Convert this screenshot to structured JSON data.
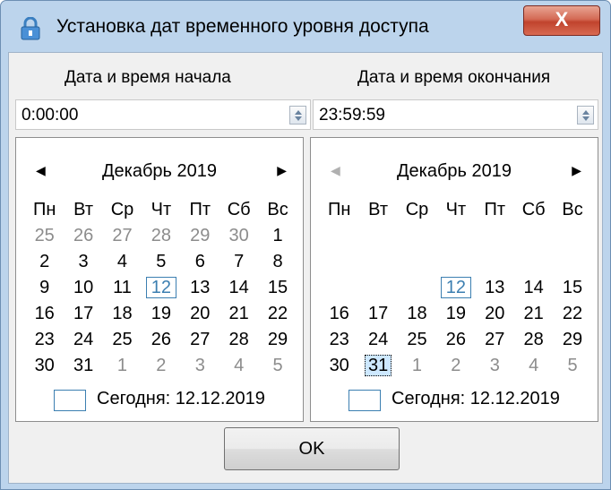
{
  "window": {
    "title": "Установка дат временного уровня доступа",
    "close_label": "X"
  },
  "start": {
    "header": "Дата и время начала",
    "time_value": "0:00:00",
    "month_label": "Декабрь 2019",
    "weekdays": [
      "Пн",
      "Вт",
      "Ср",
      "Чт",
      "Пт",
      "Сб",
      "Вс"
    ],
    "weeks": [
      [
        {
          "d": "25",
          "cls": "other"
        },
        {
          "d": "26",
          "cls": "other"
        },
        {
          "d": "27",
          "cls": "other"
        },
        {
          "d": "28",
          "cls": "other"
        },
        {
          "d": "29",
          "cls": "other"
        },
        {
          "d": "30",
          "cls": "other"
        },
        {
          "d": "1",
          "cls": ""
        }
      ],
      [
        {
          "d": "2",
          "cls": ""
        },
        {
          "d": "3",
          "cls": ""
        },
        {
          "d": "4",
          "cls": ""
        },
        {
          "d": "5",
          "cls": ""
        },
        {
          "d": "6",
          "cls": ""
        },
        {
          "d": "7",
          "cls": ""
        },
        {
          "d": "8",
          "cls": ""
        }
      ],
      [
        {
          "d": "9",
          "cls": ""
        },
        {
          "d": "10",
          "cls": ""
        },
        {
          "d": "11",
          "cls": ""
        },
        {
          "d": "12",
          "cls": "today"
        },
        {
          "d": "13",
          "cls": ""
        },
        {
          "d": "14",
          "cls": ""
        },
        {
          "d": "15",
          "cls": ""
        }
      ],
      [
        {
          "d": "16",
          "cls": ""
        },
        {
          "d": "17",
          "cls": ""
        },
        {
          "d": "18",
          "cls": ""
        },
        {
          "d": "19",
          "cls": ""
        },
        {
          "d": "20",
          "cls": ""
        },
        {
          "d": "21",
          "cls": ""
        },
        {
          "d": "22",
          "cls": ""
        }
      ],
      [
        {
          "d": "23",
          "cls": ""
        },
        {
          "d": "24",
          "cls": ""
        },
        {
          "d": "25",
          "cls": ""
        },
        {
          "d": "26",
          "cls": ""
        },
        {
          "d": "27",
          "cls": ""
        },
        {
          "d": "28",
          "cls": ""
        },
        {
          "d": "29",
          "cls": ""
        }
      ],
      [
        {
          "d": "30",
          "cls": ""
        },
        {
          "d": "31",
          "cls": ""
        },
        {
          "d": "1",
          "cls": "other"
        },
        {
          "d": "2",
          "cls": "other"
        },
        {
          "d": "3",
          "cls": "other"
        },
        {
          "d": "4",
          "cls": "other"
        },
        {
          "d": "5",
          "cls": "other"
        }
      ]
    ],
    "today_text": "Сегодня: 12.12.2019"
  },
  "end": {
    "header": "Дата и время окончания",
    "time_value": "23:59:59",
    "month_label": "Декабрь 2019",
    "weekdays": [
      "Пн",
      "Вт",
      "Ср",
      "Чт",
      "Пт",
      "Сб",
      "Вс"
    ],
    "weeks": [
      [
        {
          "d": "",
          "cls": ""
        },
        {
          "d": "",
          "cls": ""
        },
        {
          "d": "",
          "cls": ""
        },
        {
          "d": "",
          "cls": ""
        },
        {
          "d": "",
          "cls": ""
        },
        {
          "d": "",
          "cls": ""
        },
        {
          "d": "",
          "cls": ""
        }
      ],
      [
        {
          "d": "",
          "cls": ""
        },
        {
          "d": "",
          "cls": ""
        },
        {
          "d": "",
          "cls": ""
        },
        {
          "d": "",
          "cls": ""
        },
        {
          "d": "",
          "cls": ""
        },
        {
          "d": "",
          "cls": ""
        },
        {
          "d": "",
          "cls": ""
        }
      ],
      [
        {
          "d": "",
          "cls": ""
        },
        {
          "d": "",
          "cls": ""
        },
        {
          "d": "",
          "cls": ""
        },
        {
          "d": "12",
          "cls": "today"
        },
        {
          "d": "13",
          "cls": ""
        },
        {
          "d": "14",
          "cls": ""
        },
        {
          "d": "15",
          "cls": ""
        }
      ],
      [
        {
          "d": "16",
          "cls": ""
        },
        {
          "d": "17",
          "cls": ""
        },
        {
          "d": "18",
          "cls": ""
        },
        {
          "d": "19",
          "cls": ""
        },
        {
          "d": "20",
          "cls": ""
        },
        {
          "d": "21",
          "cls": ""
        },
        {
          "d": "22",
          "cls": ""
        }
      ],
      [
        {
          "d": "23",
          "cls": ""
        },
        {
          "d": "24",
          "cls": ""
        },
        {
          "d": "25",
          "cls": ""
        },
        {
          "d": "26",
          "cls": ""
        },
        {
          "d": "27",
          "cls": ""
        },
        {
          "d": "28",
          "cls": ""
        },
        {
          "d": "29",
          "cls": ""
        }
      ],
      [
        {
          "d": "30",
          "cls": ""
        },
        {
          "d": "31",
          "cls": "sel"
        },
        {
          "d": "1",
          "cls": "other"
        },
        {
          "d": "2",
          "cls": "other"
        },
        {
          "d": "3",
          "cls": "other"
        },
        {
          "d": "4",
          "cls": "other"
        },
        {
          "d": "5",
          "cls": "other"
        }
      ]
    ],
    "today_text": "Сегодня: 12.12.2019"
  },
  "ok_label": "OK",
  "colors": {
    "accent": "#3c7fb1",
    "frame": "#bcd4ec",
    "close": "#c0432d"
  }
}
